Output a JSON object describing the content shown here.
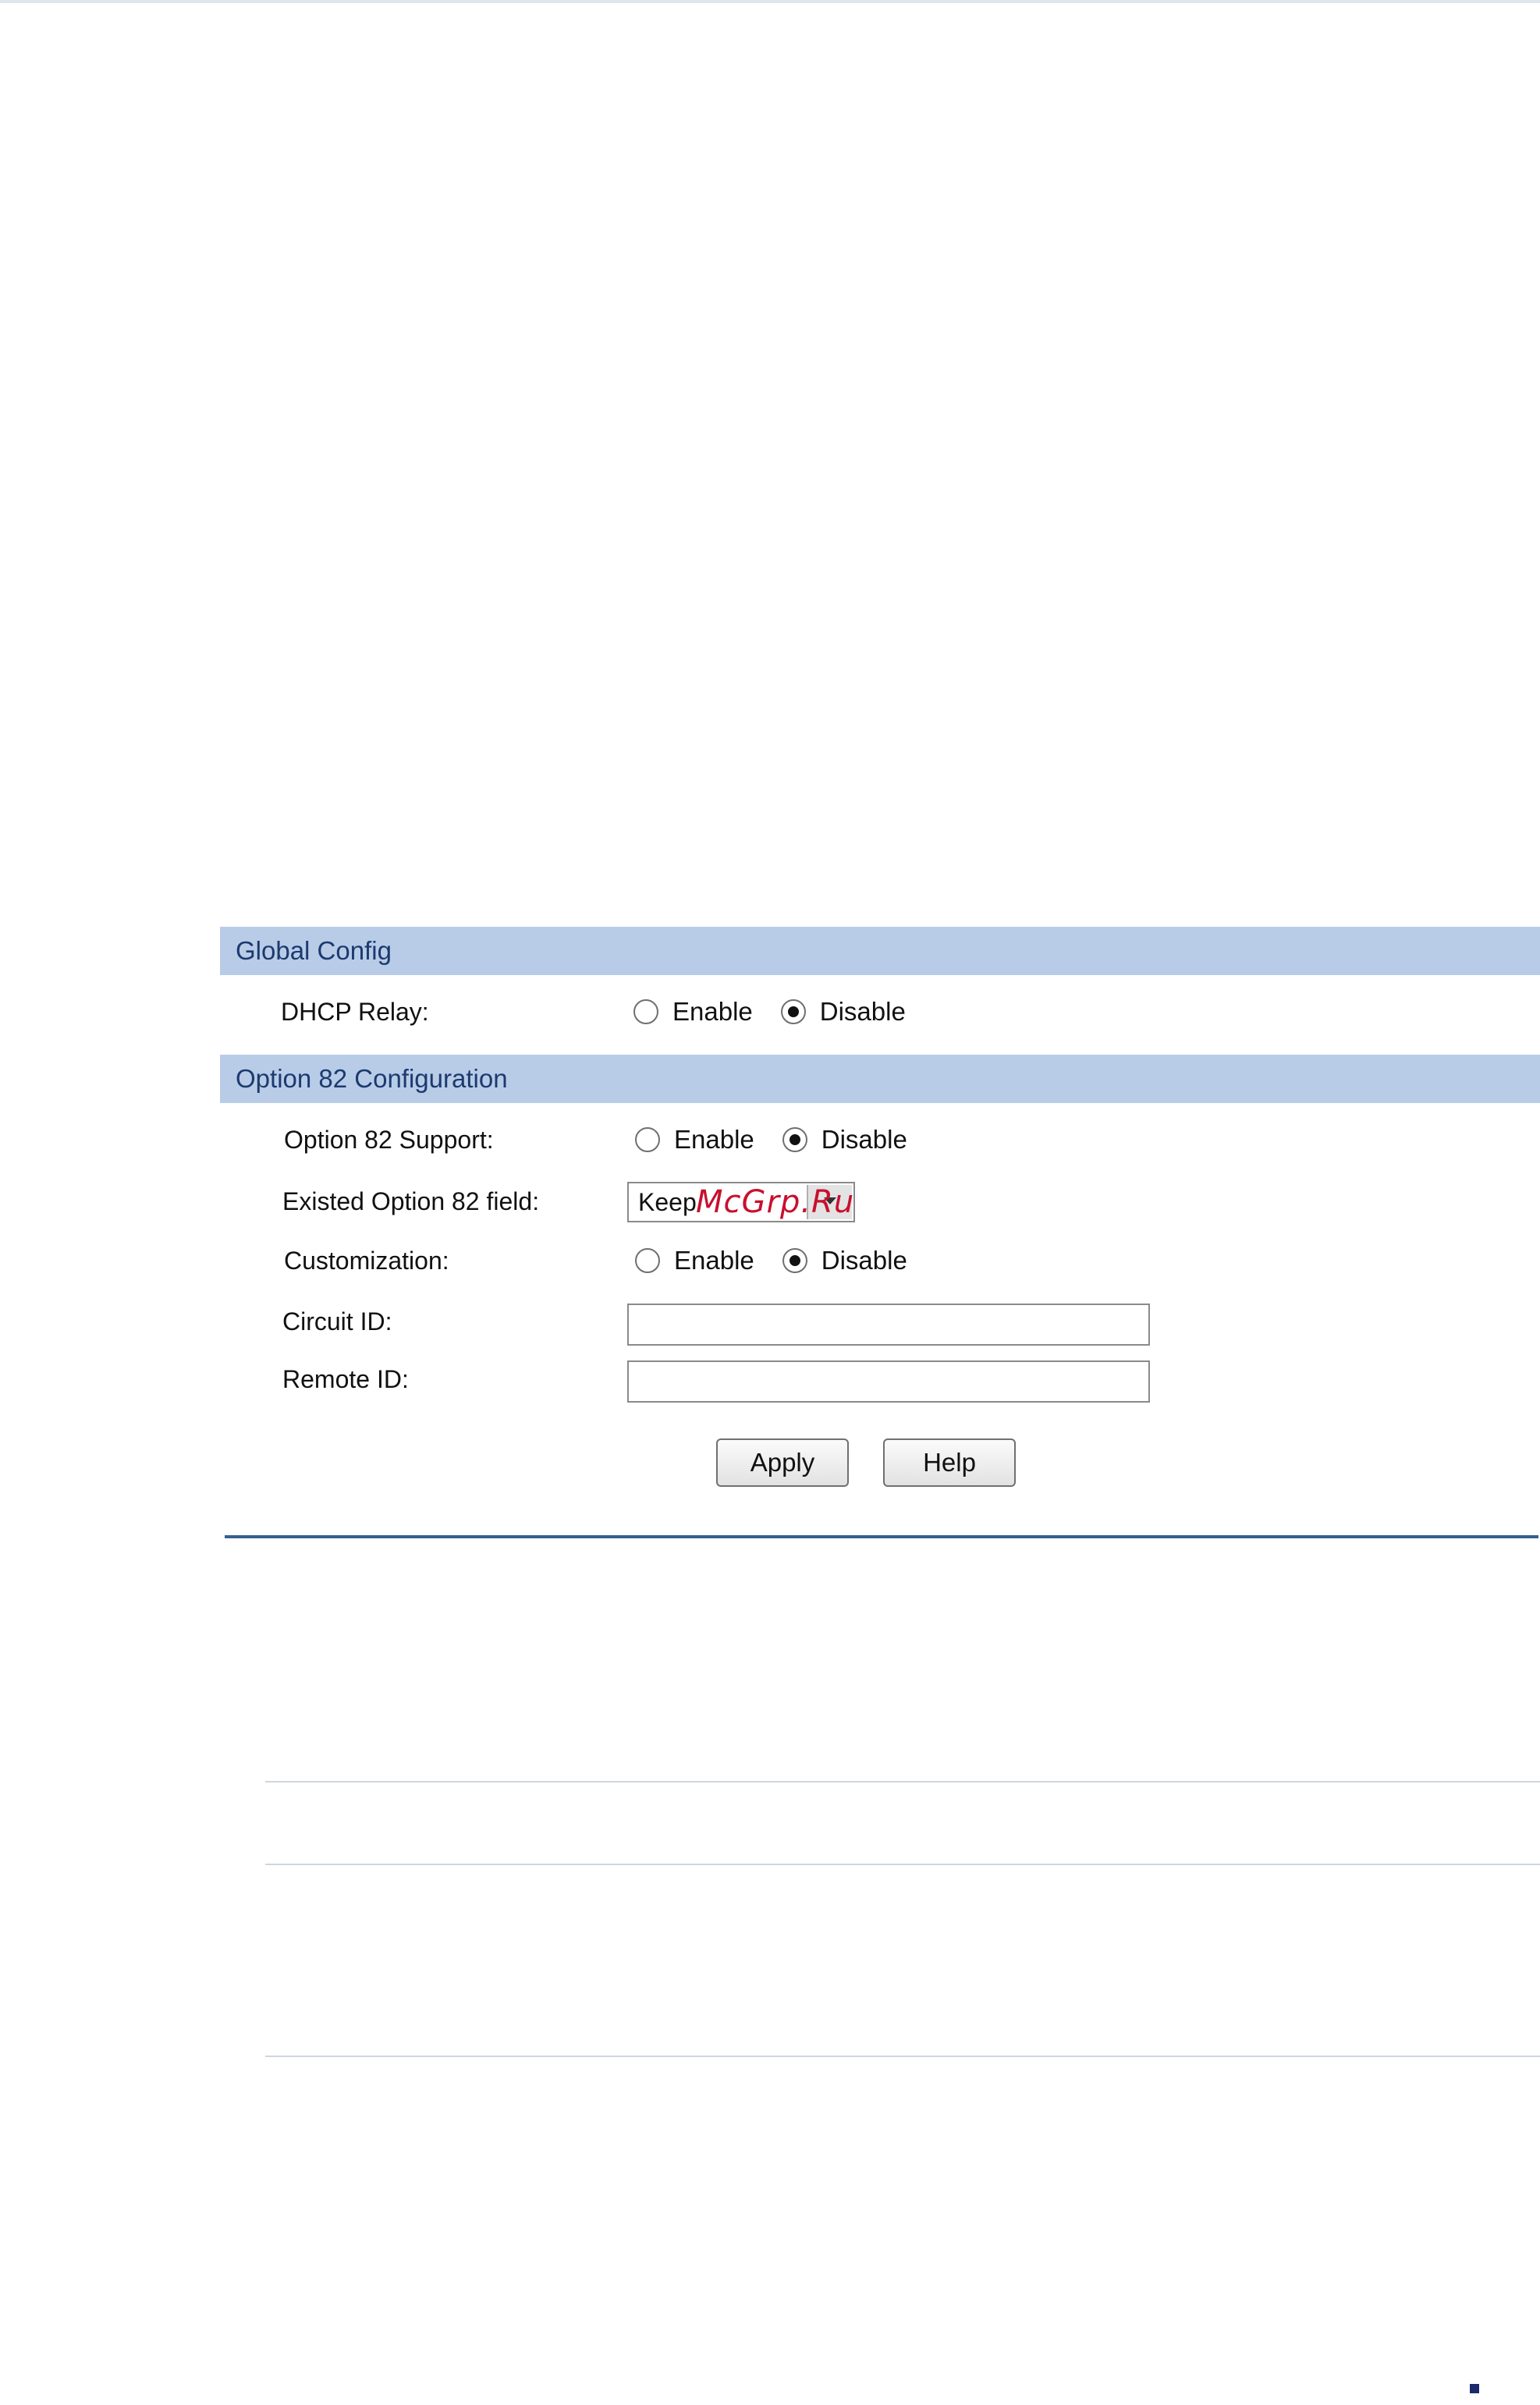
{
  "global_config": {
    "header": "Global Config",
    "dhcp_relay": {
      "label": "DHCP Relay:",
      "enable_label": "Enable",
      "disable_label": "Disable",
      "selected": "Disable"
    }
  },
  "option82": {
    "header": "Option 82 Configuration",
    "support": {
      "label": "Option 82 Support:",
      "enable_label": "Enable",
      "disable_label": "Disable",
      "selected": "Disable"
    },
    "existed_field": {
      "label": "Existed Option 82 field:",
      "value": "Keep"
    },
    "customization": {
      "label": "Customization:",
      "enable_label": "Enable",
      "disable_label": "Disable",
      "selected": "Disable"
    },
    "circuit_id": {
      "label": "Circuit ID:",
      "value": ""
    },
    "remote_id": {
      "label": "Remote ID:",
      "value": ""
    }
  },
  "buttons": {
    "apply": "Apply",
    "help": "Help"
  },
  "watermark": "McGrp.Ru",
  "colors": {
    "section_header_bg": "#b8cce8",
    "section_header_text": "#1c3a6e",
    "panel_rule": "#36608e",
    "watermark": "#c8102e"
  }
}
